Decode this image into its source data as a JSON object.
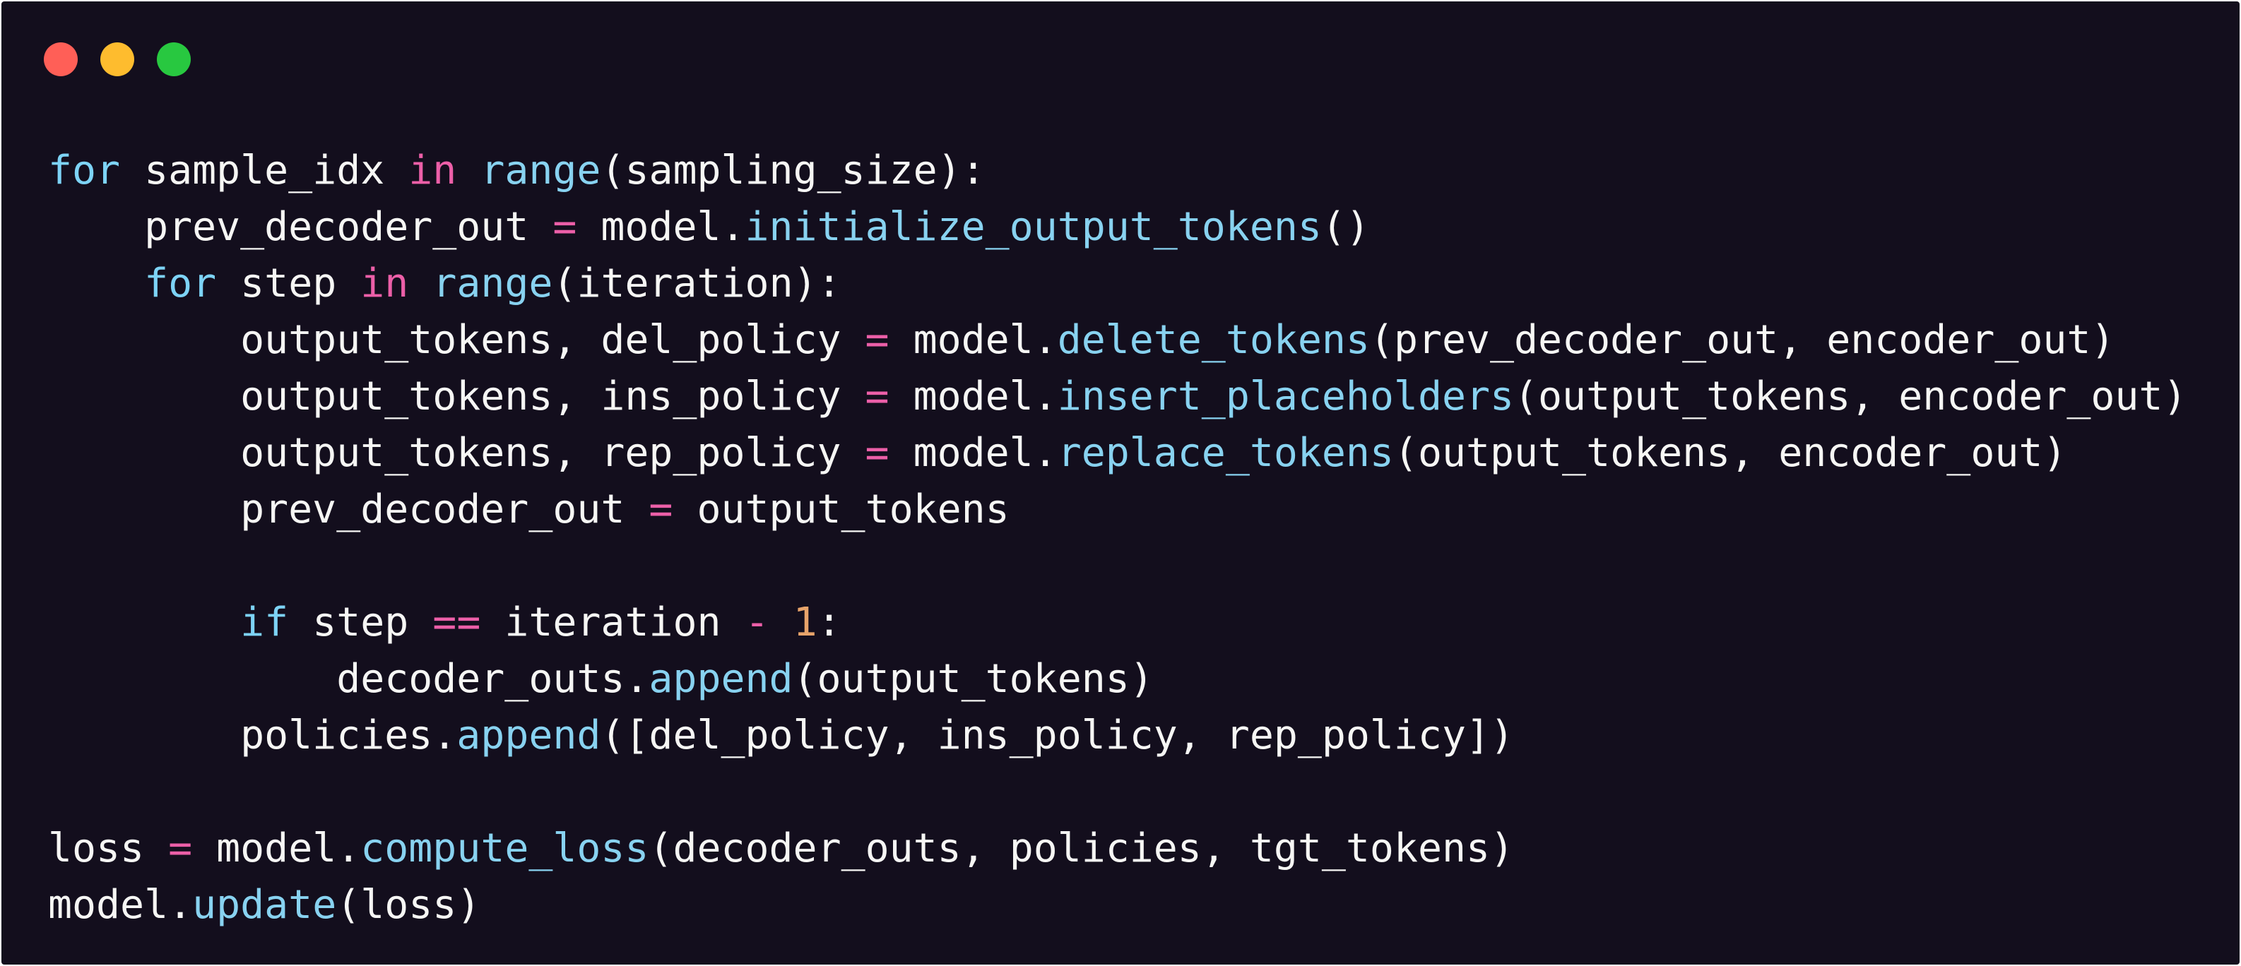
{
  "window": {
    "controls": [
      {
        "name": "close",
        "color": "#ff5f57"
      },
      {
        "name": "minimize",
        "color": "#febc2e"
      },
      {
        "name": "maximize",
        "color": "#28c840"
      }
    ]
  },
  "theme": {
    "background": "#130e1d",
    "text": "#f6f6f4",
    "keyword": "#7dd3f6",
    "operator": "#ec5fa8",
    "function": "#88d2f0",
    "number": "#e7a36a"
  },
  "code": {
    "language": "python",
    "lines": [
      [
        {
          "t": "kw",
          "v": "for"
        },
        {
          "t": "plain",
          "v": " sample_idx "
        },
        {
          "t": "op",
          "v": "in"
        },
        {
          "t": "plain",
          "v": " "
        },
        {
          "t": "fn",
          "v": "range"
        },
        {
          "t": "plain",
          "v": "(sampling_size):"
        }
      ],
      [
        {
          "t": "plain",
          "v": "    prev_decoder_out "
        },
        {
          "t": "op",
          "v": "="
        },
        {
          "t": "plain",
          "v": " model."
        },
        {
          "t": "fn",
          "v": "initialize_output_tokens"
        },
        {
          "t": "plain",
          "v": "()"
        }
      ],
      [
        {
          "t": "plain",
          "v": "    "
        },
        {
          "t": "kw",
          "v": "for"
        },
        {
          "t": "plain",
          "v": " step "
        },
        {
          "t": "op",
          "v": "in"
        },
        {
          "t": "plain",
          "v": " "
        },
        {
          "t": "fn",
          "v": "range"
        },
        {
          "t": "plain",
          "v": "(iteration):"
        }
      ],
      [
        {
          "t": "plain",
          "v": "        output_tokens, del_policy "
        },
        {
          "t": "op",
          "v": "="
        },
        {
          "t": "plain",
          "v": " model."
        },
        {
          "t": "fn",
          "v": "delete_tokens"
        },
        {
          "t": "plain",
          "v": "(prev_decoder_out, encoder_out)"
        }
      ],
      [
        {
          "t": "plain",
          "v": "        output_tokens, ins_policy "
        },
        {
          "t": "op",
          "v": "="
        },
        {
          "t": "plain",
          "v": " model."
        },
        {
          "t": "fn",
          "v": "insert_placeholders"
        },
        {
          "t": "plain",
          "v": "(output_tokens, encoder_out)"
        }
      ],
      [
        {
          "t": "plain",
          "v": "        output_tokens, rep_policy "
        },
        {
          "t": "op",
          "v": "="
        },
        {
          "t": "plain",
          "v": " model."
        },
        {
          "t": "fn",
          "v": "replace_tokens"
        },
        {
          "t": "plain",
          "v": "(output_tokens, encoder_out)"
        }
      ],
      [
        {
          "t": "plain",
          "v": "        prev_decoder_out "
        },
        {
          "t": "op",
          "v": "="
        },
        {
          "t": "plain",
          "v": " output_tokens"
        }
      ],
      [],
      [
        {
          "t": "plain",
          "v": "        "
        },
        {
          "t": "kw",
          "v": "if"
        },
        {
          "t": "plain",
          "v": " step "
        },
        {
          "t": "op",
          "v": "=="
        },
        {
          "t": "plain",
          "v": " iteration "
        },
        {
          "t": "op",
          "v": "-"
        },
        {
          "t": "plain",
          "v": " "
        },
        {
          "t": "num",
          "v": "1"
        },
        {
          "t": "plain",
          "v": ":"
        }
      ],
      [
        {
          "t": "plain",
          "v": "            decoder_outs."
        },
        {
          "t": "fn",
          "v": "append"
        },
        {
          "t": "plain",
          "v": "(output_tokens)"
        }
      ],
      [
        {
          "t": "plain",
          "v": "        policies."
        },
        {
          "t": "fn",
          "v": "append"
        },
        {
          "t": "plain",
          "v": "([del_policy, ins_policy, rep_policy])"
        }
      ],
      [],
      [
        {
          "t": "plain",
          "v": "loss "
        },
        {
          "t": "op",
          "v": "="
        },
        {
          "t": "plain",
          "v": " model."
        },
        {
          "t": "fn",
          "v": "compute_loss"
        },
        {
          "t": "plain",
          "v": "(decoder_outs, policies, tgt_tokens)"
        }
      ],
      [
        {
          "t": "plain",
          "v": "model."
        },
        {
          "t": "fn",
          "v": "update"
        },
        {
          "t": "plain",
          "v": "(loss)"
        }
      ]
    ]
  }
}
